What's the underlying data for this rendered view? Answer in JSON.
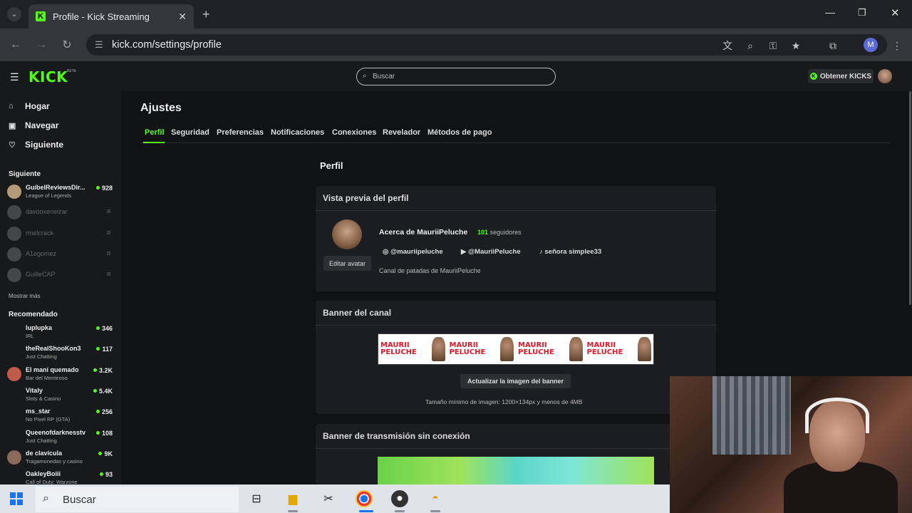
{
  "browser": {
    "tab_title": "Profile - Kick Streaming",
    "url": "kick.com/settings/profile",
    "profile_initial": "M",
    "tab_close": "✕",
    "new_tab": "+"
  },
  "header": {
    "logo": "KICK",
    "logo_tag": "BETA",
    "search_placeholder": "Buscar",
    "get_kicks": "Obtener KICKS"
  },
  "sidebar": {
    "nav": [
      {
        "label": "Hogar",
        "icon": "home-icon"
      },
      {
        "label": "Navegar",
        "icon": "browse-icon"
      },
      {
        "label": "Siguiente",
        "icon": "heart-icon"
      }
    ],
    "following_title": "Siguiente",
    "following": [
      {
        "name": "GuibelReviewsDir...",
        "category": "League of Legends",
        "viewers": "928",
        "live": true,
        "color": "#b49a7a"
      },
      {
        "name": "davooxeneizar",
        "live": false,
        "color": "#9a9a9a"
      },
      {
        "name": "rmelcrack",
        "live": false,
        "color": "#9a9a9a"
      },
      {
        "name": "A1egomez",
        "live": false,
        "color": "#9a9a9a"
      },
      {
        "name": "GuilleCAP",
        "live": false,
        "color": "#9a9a9a"
      }
    ],
    "show_more": "Mostrar más",
    "recommended_title": "Recomendado",
    "recommended": [
      {
        "name": "luplupka",
        "category": "IRL",
        "viewers": "346",
        "color": ""
      },
      {
        "name": "theRealShooKon3",
        "category": "Just Chatting",
        "viewers": "117",
        "color": ""
      },
      {
        "name": "El maní quemado",
        "category": "Bar del Mentiroso",
        "viewers": "3.2K",
        "color": "#c05a4a"
      },
      {
        "name": "Vitaly",
        "category": "Slots & Casino",
        "viewers": "5.4K",
        "color": ""
      },
      {
        "name": "ms_star",
        "category": "No Pixel RP (GTA)",
        "viewers": "256",
        "color": ""
      },
      {
        "name": "Queenofdarknesstv",
        "category": "Just Chatting",
        "viewers": "108",
        "color": ""
      },
      {
        "name": "de clavícula",
        "category": "Tragamonedas y casino",
        "viewers": "9K",
        "color": "#8a6a5a"
      },
      {
        "name": "OakleyBoiii",
        "category": "Call of Duty: Warzone",
        "viewers": "93",
        "color": ""
      }
    ]
  },
  "settings": {
    "title": "Ajustes",
    "tabs": [
      "Perfil",
      "Seguridad",
      "Preferencias",
      "Notificaciones",
      "Conexiones",
      "Revelador",
      "Métodos de pago"
    ],
    "active_tab": "Perfil",
    "section_title": "Perfil",
    "preview": {
      "title": "Vista previa del perfil",
      "about": "Acerca de MauriiPeluche",
      "followers_count": "101",
      "followers_label": "seguidores",
      "edit_avatar": "Editar avatar",
      "instagram": "@mauriipeluche",
      "youtube": "@MauriiPeluche",
      "tiktok": "señora simplee33",
      "bio": "Canal de patadas de MauriiPeluche"
    },
    "banner": {
      "title": "Banner del canal",
      "banner_text": "MAURII PELUCHE",
      "update_button": "Actualizar la imagen del banner",
      "size_note": "Tamaño mínimo de imagen: 1200×134px y menos de 4MB"
    },
    "offline": {
      "title": "Banner de transmisión sin conexión"
    }
  },
  "taskbar": {
    "search": "Buscar",
    "apps": [
      "task-view-icon",
      "file-explorer-icon",
      "capcut-icon",
      "chrome-icon",
      "obs-icon",
      "burger-app-icon"
    ]
  },
  "colors": {
    "accent": "#53fc18",
    "background": "#111214",
    "panel": "#1c1d20"
  }
}
